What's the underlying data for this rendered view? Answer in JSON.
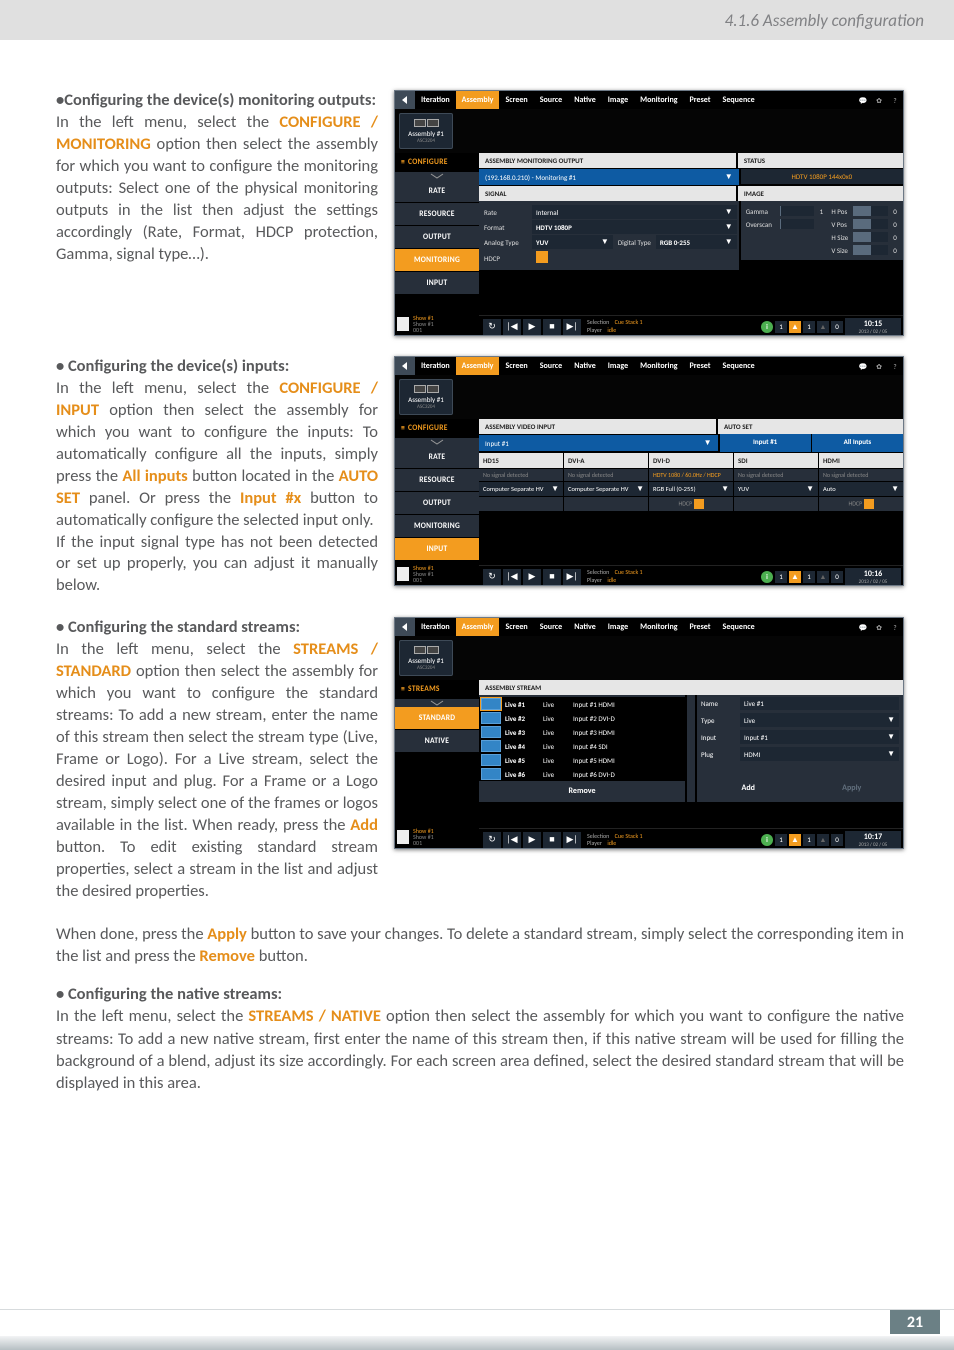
{
  "page": {
    "running_head": "4.1.6 Assembly configuration",
    "number": "21"
  },
  "sections": {
    "monitoring": {
      "heading_bullet": "•",
      "heading": "Configuring the device(s) monitoring outputs:",
      "pre": "In the left menu, select the ",
      "link": "CONFIGURE / MONITORING",
      "post": " option then select the assembly for which you want to configure the monitoring outputs: Select one of the physical monitoring outputs in the list then adjust the settings accordingly (Rate, Format, HDCP protection, Gamma, signal type…)."
    },
    "inputs": {
      "heading_bullet": "•",
      "heading": " Configuring the device(s) inputs:",
      "pre1": "In the left menu, select the ",
      "link1": "CONFIGURE / INPUT",
      "post1": " option then select the assembly for which you want to configure the inputs: To automatically configure all the inputs, simply press the ",
      "link2": "All inputs",
      "post2": " button located in the ",
      "link3": "AUTO SET",
      "post3": " panel. Or press the ",
      "link4": "Input #x",
      "post4": " button to automatically configure the selected input only.",
      "para2": "If the input signal type has not been detected or set up properly, you can adjust it manually below."
    },
    "standard": {
      "heading_bullet": "•",
      "heading": " Configuring the standard streams:",
      "pre": "In the left menu, select the ",
      "link": "STREAMS / STANDARD",
      "post": " option then select the assembly for which you want to configure the standard streams: To add a new stream, enter the name of this stream then select the stream type (Live, Frame or Logo). For a Live stream, select the desired input and plug. For a Frame or a Logo stream, simply select one of the frames or logos available in the list. When ready, press the ",
      "link2": "Add",
      "post2": " button. To edit existing standard stream properties, select a stream in the list and adjust the desired properties.",
      "full1_pre": "When done, press the ",
      "full1_link": "Apply",
      "full1_mid": " button to save your changes. To delete a standard stream, simply select the corresponding item in the list and press the ",
      "full1_link2": "Remove",
      "full1_post": " button."
    },
    "native": {
      "heading_bullet": "•",
      "heading": " Configuring the native streams:",
      "pre": "In the left menu, select the ",
      "link": "STREAMS / NATIVE",
      "post": " option then select the assembly for which you want to configure the native streams: To add a new native stream, first enter the name of this stream then, if this native stream will be used for filling the background of a blend, adjust its size accordingly. For each screen area defined, select the desired standard stream that will be displayed in this area."
    }
  },
  "app_common": {
    "menubar": [
      "Iteration",
      "Assembly",
      "Screen",
      "Source",
      "Native",
      "Image",
      "Monitoring",
      "Preset",
      "Sequence"
    ],
    "assembly_chip_title": "Assembly #1",
    "assembly_chip_sub": "ASC3204",
    "bottombar": {
      "selection_label": "Selection",
      "selection_val": "Cue Stack 1",
      "player_label": "Player",
      "player_val": "idle",
      "left_line1": "Show #1",
      "left_line2": "Show #1",
      "left_line3": "001"
    }
  },
  "shot1": {
    "side_top": "CONFIGURE",
    "side_items": [
      "RATE",
      "RESOURCE",
      "OUTPUT",
      "MONITORING",
      "INPUT"
    ],
    "side_active_index": 3,
    "panel_left": "ASSEMBLY MONITORING OUTPUT",
    "panel_right": "STATUS",
    "monitor_select": "(192.168.0.210) - Monitoring #1",
    "status_text": "HDTV 1080P 144x0x0",
    "signal": "SIGNAL",
    "image": "IMAGE",
    "fields": {
      "rate_label": "Rate",
      "rate_value": "Internal",
      "format_label": "Format",
      "format_value": "HDTV 1080P",
      "analog_label": "Analog Type",
      "analog_value": "YUV",
      "digital_label": "Digital Type",
      "digital_value": "RGB 0-255",
      "hdcp_label": "HDCP"
    },
    "image_fields": {
      "gamma": "Gamma",
      "gamma_val": "1",
      "overscan": "Overscan",
      "hpos": "H Pos",
      "vpos": "V Pos",
      "hsize": "H Size",
      "vsize": "V Size",
      "zero": "0"
    },
    "time": "10:15",
    "date": "2013 / 02 / 05"
  },
  "shot2": {
    "side_top": "CONFIGURE",
    "side_items": [
      "RATE",
      "RESOURCE",
      "OUTPUT",
      "MONITORING",
      "INPUT"
    ],
    "side_active_index": 4,
    "panel_left": "ASSEMBLY VIDEO INPUT",
    "panel_right": "AUTO SET",
    "input_select": "Input #1",
    "autoset_input": "Input #1",
    "autoset_all": "All Inputs",
    "cols": [
      "HD15",
      "DVI-A",
      "DVI-D",
      "SDI",
      "HDMI"
    ],
    "subs": [
      "No signal detected",
      "No signal detected",
      "HDTV 1080 / 60.0Hz / HDCP",
      "No signal detected",
      "No signal detected"
    ],
    "dds": [
      "Computer Separate HV",
      "Computer Separate HV",
      "RGB Full (0-255)",
      "YUV",
      "Auto"
    ],
    "hdcp": "HDCP",
    "time": "10:16",
    "date": "2013 / 02 / 05"
  },
  "shot3": {
    "side_top": "STREAMS",
    "side_items": [
      "STANDARD",
      "NATIVE"
    ],
    "side_active_index": 0,
    "panel": "ASSEMBLY STREAM",
    "rows": [
      {
        "name": "Live #1",
        "type": "Live",
        "src": "Input #1 HDMI"
      },
      {
        "name": "Live #2",
        "type": "Live",
        "src": "Input #2 DVI-D"
      },
      {
        "name": "Live #3",
        "type": "Live",
        "src": "Input #3 HDMI"
      },
      {
        "name": "Live #4",
        "type": "Live",
        "src": "Input #4 SDI"
      },
      {
        "name": "Live #5",
        "type": "Live",
        "src": "Input #5 HDMI"
      },
      {
        "name": "Live #6",
        "type": "Live",
        "src": "Input #6 DVI-D"
      }
    ],
    "selected_row": 0,
    "props": {
      "name_label": "Name",
      "name_value": "Live #1",
      "type_label": "Type",
      "type_value": "Live",
      "input_label": "Input",
      "input_value": "Input #1",
      "plug_label": "Plug",
      "plug_value": "HDMI"
    },
    "buttons": {
      "remove": "Remove",
      "add": "Add",
      "apply": "Apply"
    },
    "time": "10:17",
    "date": "2013 / 02 / 05"
  }
}
